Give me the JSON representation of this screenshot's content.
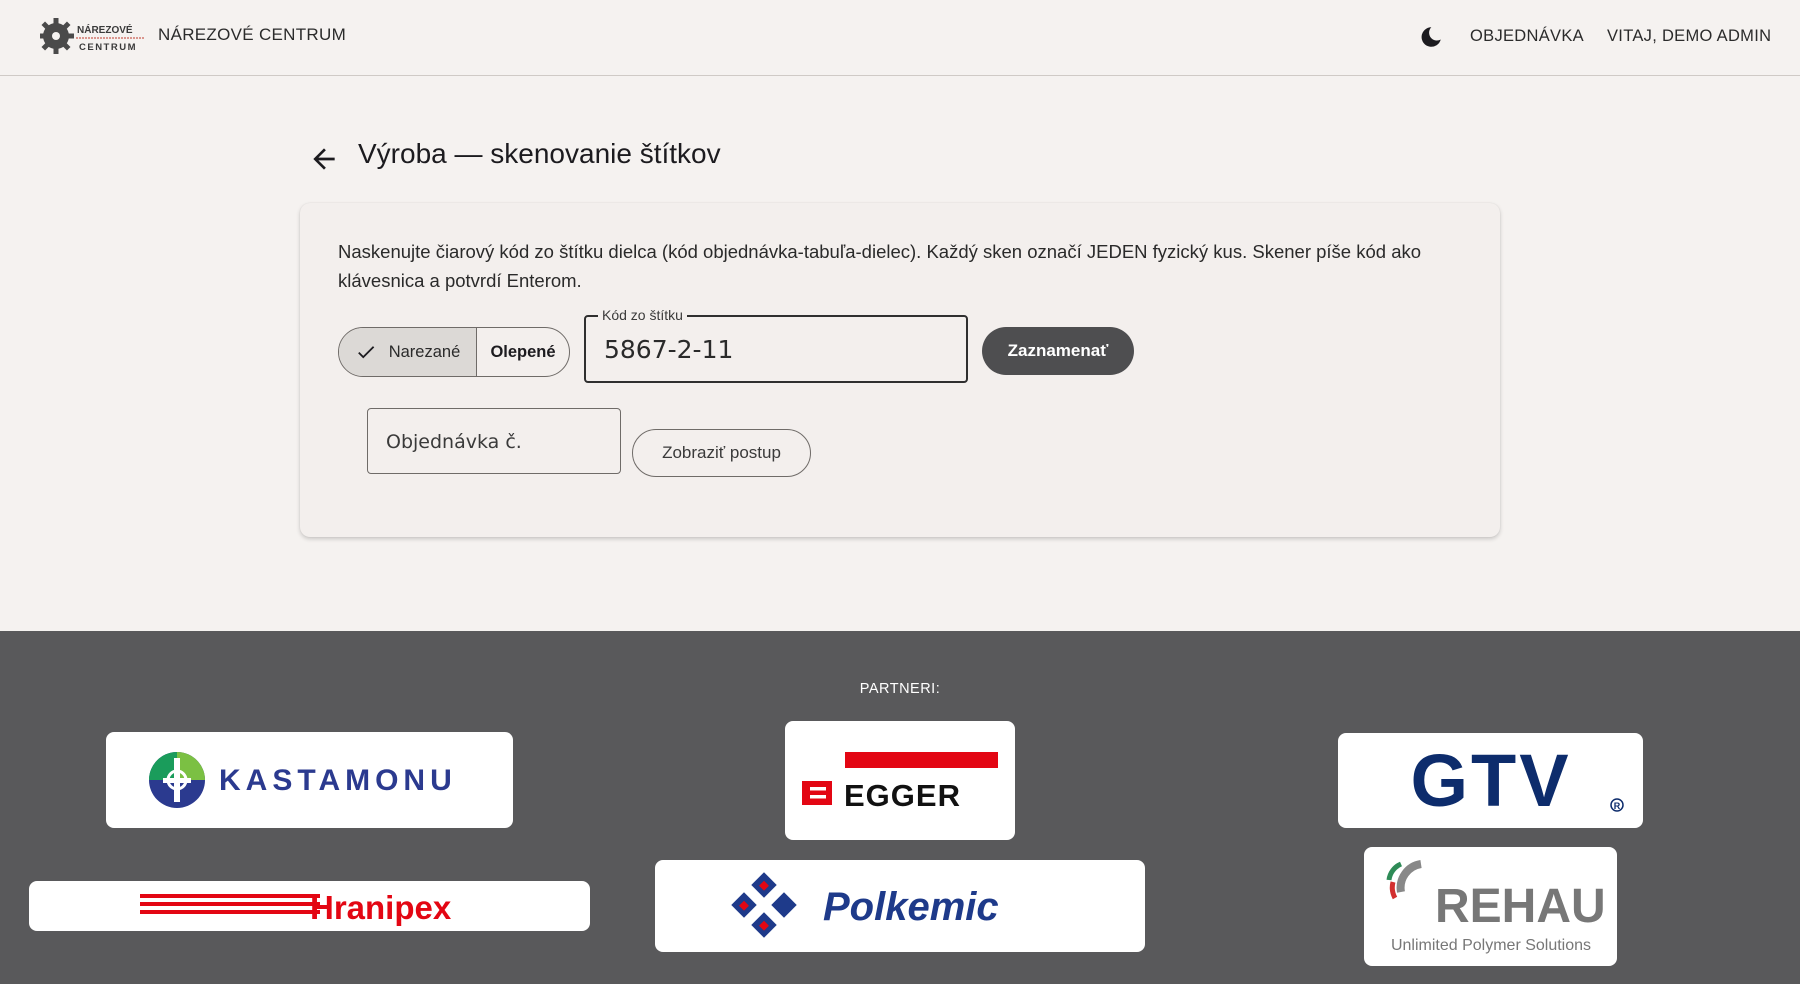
{
  "header": {
    "brand_logo_line1": "NÁREZOVÉ",
    "brand_logo_line2": "CENTRUM",
    "brand_title": "NÁREZOVÉ CENTRUM",
    "nav_order": "OBJEDNÁVKA",
    "nav_user": "VITAJ, DEMO ADMIN"
  },
  "page": {
    "title": "Výroba — skenovanie štítkov"
  },
  "scan": {
    "instructions": "Naskenujte čiarový kód zo štítku dielca (kód objednávka-tabuľa-dielec). Každý sken označí JEDEN fyzický kus. Skener píše kód ako klávesnica a potvrdí Enterom.",
    "mode_cut_label": "Narezané",
    "mode_glued_label": "Olepené",
    "selected_mode": "Narezané",
    "code_label": "Kód zo štítku",
    "code_value": "5867-2-11",
    "record_button": "Zaznamenať",
    "order_placeholder": "Objednávka č.",
    "show_progress_button": "Zobraziť postup"
  },
  "footer": {
    "partners_label": "PARTNERI:",
    "partners": {
      "kastamonu": "KASTAMONU",
      "egger": "EGGER",
      "gtv": "GTV",
      "hranipex": "Hranipex",
      "polkemic": "Polkemic",
      "rehau": "REHAU",
      "rehau_tagline": "Unlimited Polymer Solutions"
    }
  },
  "colors": {
    "accent_dark": "#4e4e50",
    "footer_bg": "#59595b",
    "page_bg": "#f5f2f0",
    "egger_red": "#e30613",
    "gtv_blue": "#0d2c6c",
    "polkemic_blue": "#1e3a8a",
    "hranipex_red": "#e30613"
  },
  "icons": {
    "theme_toggle": "moon-icon",
    "back": "arrow-left-icon",
    "selected": "check-icon"
  }
}
